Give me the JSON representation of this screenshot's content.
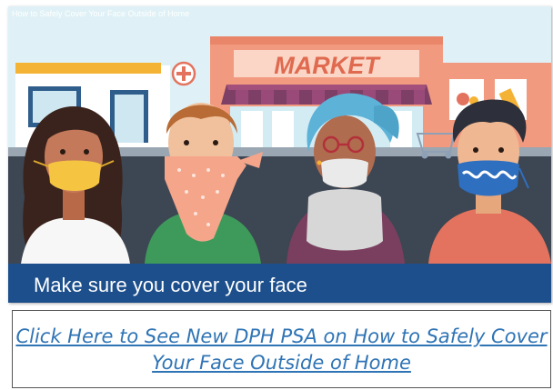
{
  "video": {
    "title": "How to Safely Cover Your Face Outside of Home",
    "store_sign": "MARKET",
    "caption": "Make sure you cover your face"
  },
  "link": {
    "text": "Click Here to See New DPH PSA on How to Safely Cover Your Face Outside of Home"
  },
  "colors": {
    "caption_bar": "#1d4f8c",
    "link": "#2f74b5",
    "sky": "#dff1f6"
  }
}
